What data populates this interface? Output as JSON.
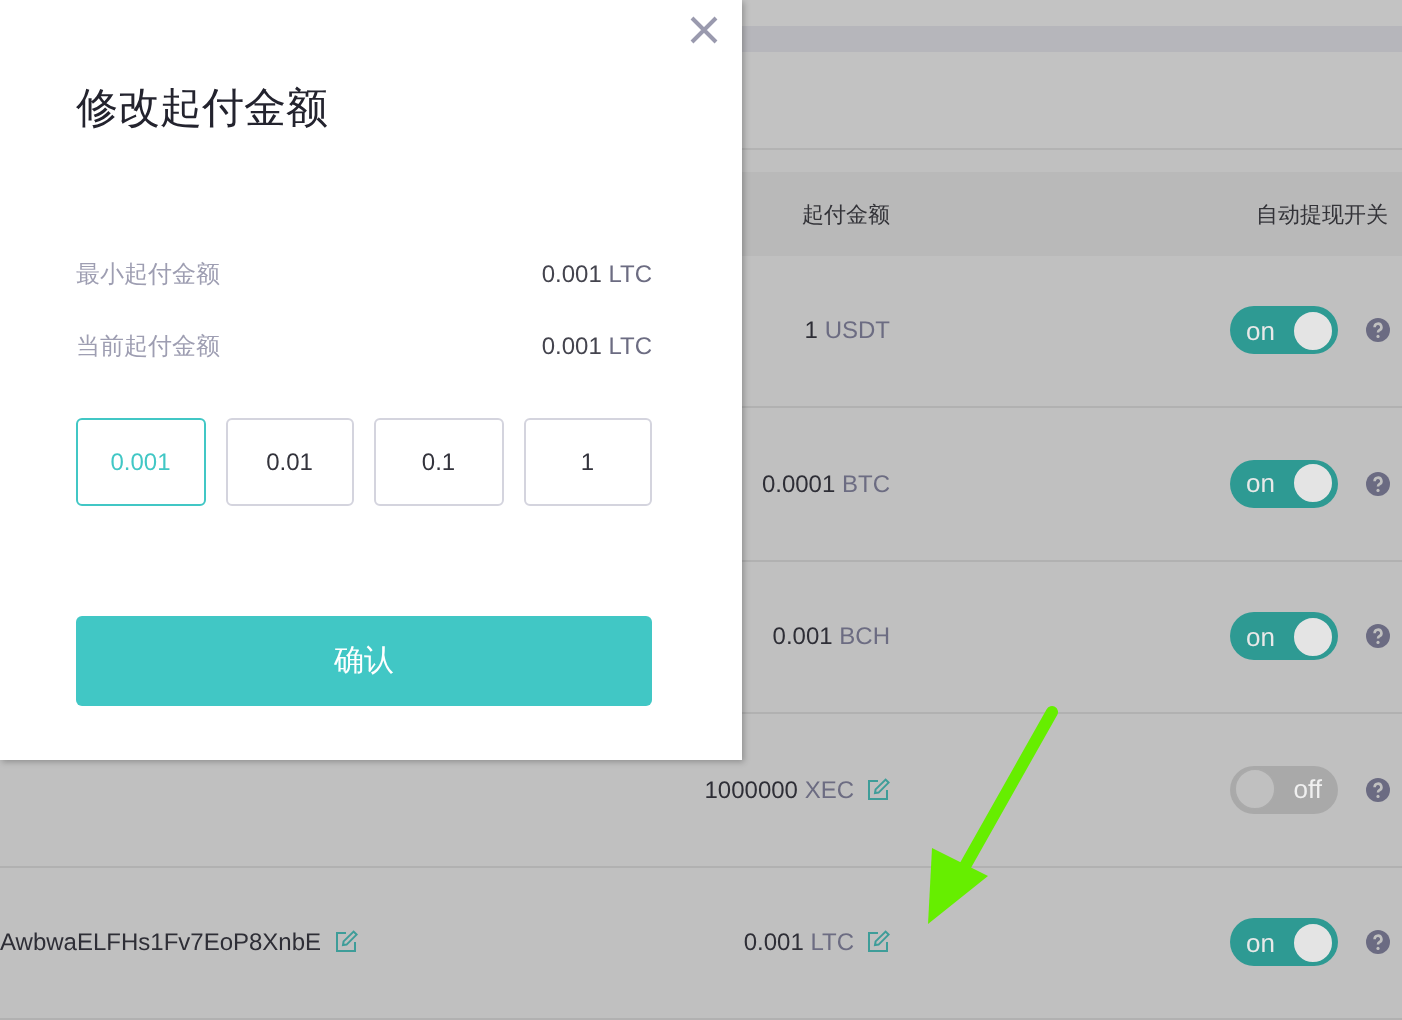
{
  "table": {
    "columns": [
      {
        "label": "起付金额"
      },
      {
        "label": "自动提现开关"
      }
    ],
    "rows": [
      {
        "address": "",
        "amount": "1",
        "unit": "USDT",
        "editable": false,
        "on": true,
        "switch_label": "on"
      },
      {
        "address": "",
        "amount": "0.0001",
        "unit": "BTC",
        "editable": false,
        "on": true,
        "switch_label": "on"
      },
      {
        "address": "",
        "amount": "0.001",
        "unit": "BCH",
        "editable": false,
        "on": true,
        "switch_label": "on"
      },
      {
        "address": "",
        "amount": "1000000",
        "unit": "XEC",
        "editable": true,
        "on": false,
        "switch_label": "off"
      },
      {
        "address": "AwbwaELFHs1Fv7EoP8XnbE",
        "amount": "0.001",
        "unit": "LTC",
        "editable": true,
        "on": true,
        "switch_label": "on"
      }
    ]
  },
  "dialog": {
    "title": "修改起付金额",
    "fields": [
      {
        "label": "最小起付金额",
        "value": "0.001",
        "unit": "LTC"
      },
      {
        "label": "当前起付金额",
        "value": "0.001",
        "unit": "LTC"
      }
    ],
    "presets": [
      {
        "label": "0.001",
        "selected": true
      },
      {
        "label": "0.01",
        "selected": false
      },
      {
        "label": "0.1",
        "selected": false
      },
      {
        "label": "1",
        "selected": false
      }
    ],
    "confirm": "确认"
  }
}
